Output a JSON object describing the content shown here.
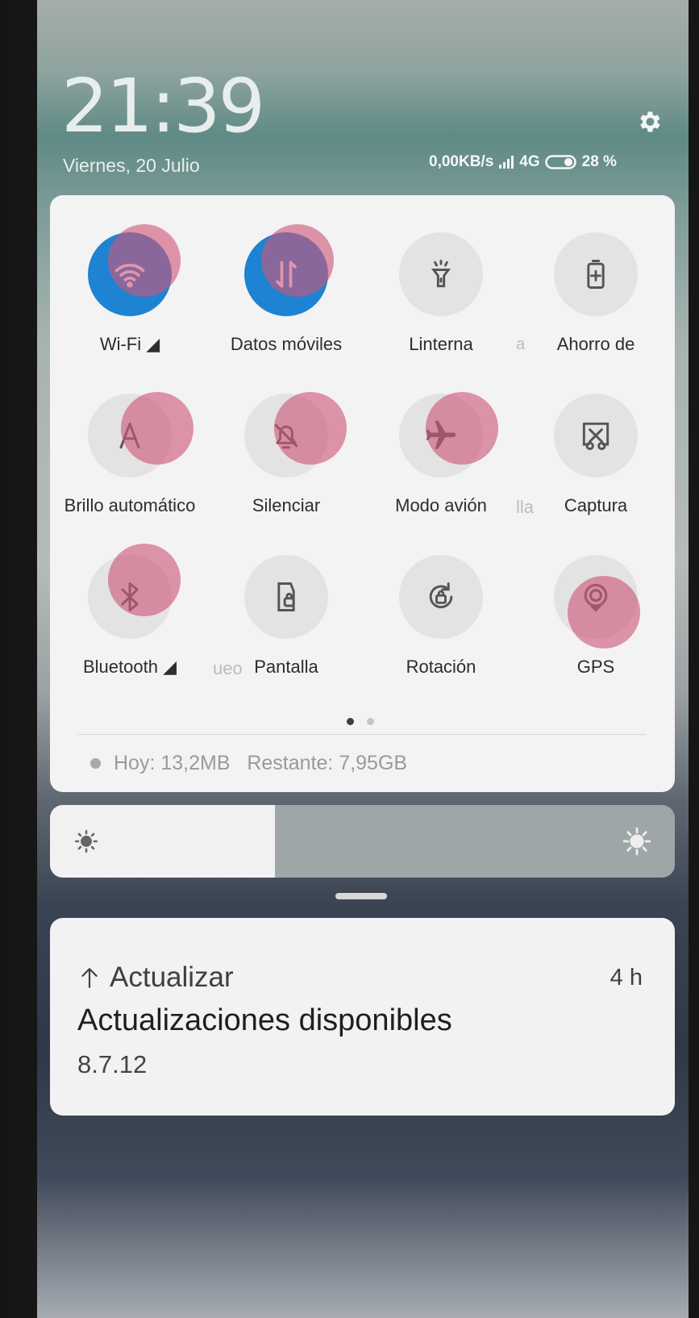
{
  "status_bar": {
    "time": "21:39",
    "date": "Viernes, 20 Julio",
    "network_speed": "0,00KB/s",
    "network_type": "4G",
    "battery": "28 %"
  },
  "quick_settings": {
    "tiles": [
      {
        "label": "Wi-Fi ◢",
        "icon": "wifi-icon",
        "active": true
      },
      {
        "label": "Datos móviles",
        "icon": "mobile-data-icon",
        "active": true
      },
      {
        "label": "Linterna",
        "icon": "flashlight-icon",
        "active": false
      },
      {
        "label": "Ahorro de",
        "icon": "battery-saver-icon",
        "active": false
      },
      {
        "label": "Brillo automático",
        "icon": "auto-brightness-icon",
        "active": false
      },
      {
        "label": "Silenciar",
        "icon": "mute-bell-icon",
        "active": false
      },
      {
        "label": "Modo avión",
        "icon": "airplane-icon",
        "active": false
      },
      {
        "label": "Captura",
        "icon": "screenshot-icon",
        "active": false
      },
      {
        "label": "Bluetooth ◢",
        "icon": "bluetooth-icon",
        "active": false
      },
      {
        "label": "Pantalla",
        "icon": "screen-lock-icon",
        "active": false
      },
      {
        "label": "Rotación",
        "icon": "rotation-lock-icon",
        "active": false
      },
      {
        "label": "GPS",
        "icon": "gps-icon",
        "active": false
      }
    ],
    "ghost_labels": [
      "a",
      "lla",
      "ueo"
    ],
    "data_usage": "Hoy: 13,2MB   Restante: 7,95GB",
    "page_count": 2,
    "active_page": 1
  },
  "brightness": {
    "level": 0.36
  },
  "notification": {
    "app": "Actualizar",
    "time": "4 h",
    "title": "Actualizaciones disponibles",
    "text": "8.7.12"
  },
  "colors": {
    "active_tile": "#1d83d2",
    "tap_marker": "#cd5578"
  }
}
